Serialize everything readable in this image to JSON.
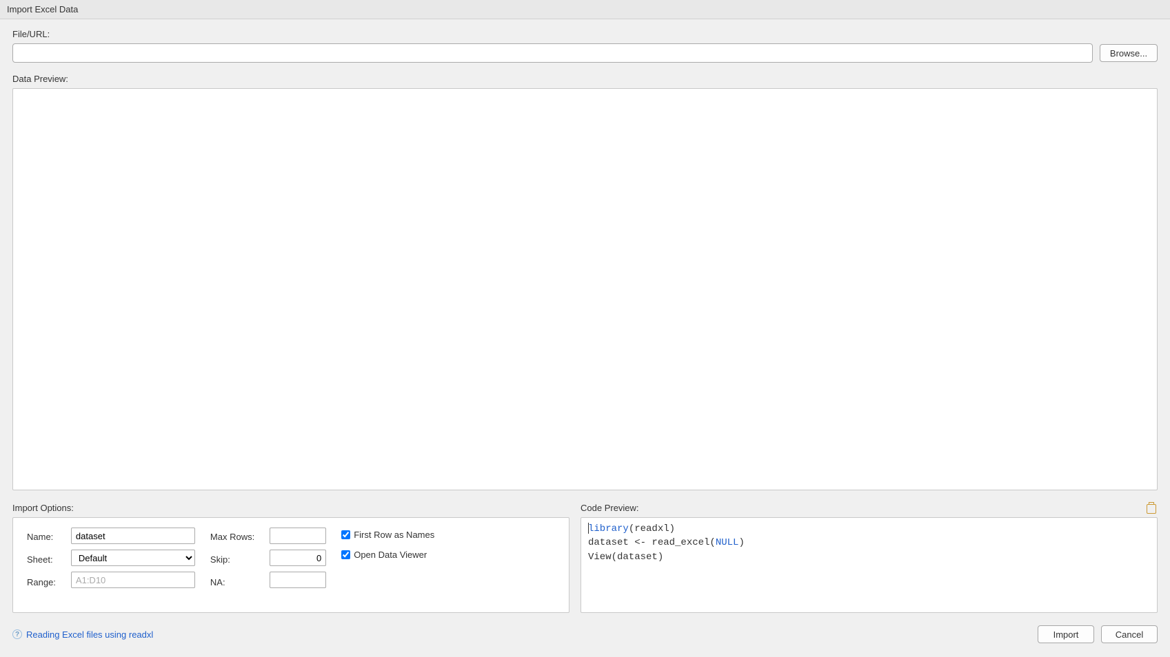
{
  "title": "Import Excel Data",
  "fileUrl": {
    "label": "File/URL:",
    "value": "",
    "browse": "Browse..."
  },
  "dataPreview": {
    "label": "Data Preview:"
  },
  "importOptions": {
    "label": "Import Options:",
    "name": {
      "label": "Name:",
      "value": "dataset"
    },
    "sheet": {
      "label": "Sheet:",
      "value": "Default"
    },
    "range": {
      "label": "Range:",
      "placeholder": "A1:D10",
      "value": ""
    },
    "maxRows": {
      "label": "Max Rows:",
      "value": ""
    },
    "skip": {
      "label": "Skip:",
      "value": "0"
    },
    "na": {
      "label": "NA:",
      "value": ""
    },
    "firstRow": {
      "label": "First Row as Names",
      "checked": true
    },
    "openViewer": {
      "label": "Open Data Viewer",
      "checked": true
    }
  },
  "codePreview": {
    "label": "Code Preview:",
    "tokens": {
      "library": "library",
      "readxl": "(readxl)",
      "assign": "dataset <- read_excel(",
      "null": "NULL",
      "close": ")",
      "view": "View(dataset)"
    }
  },
  "help": {
    "text": "Reading Excel files using readxl"
  },
  "buttons": {
    "import": "Import",
    "cancel": "Cancel"
  }
}
